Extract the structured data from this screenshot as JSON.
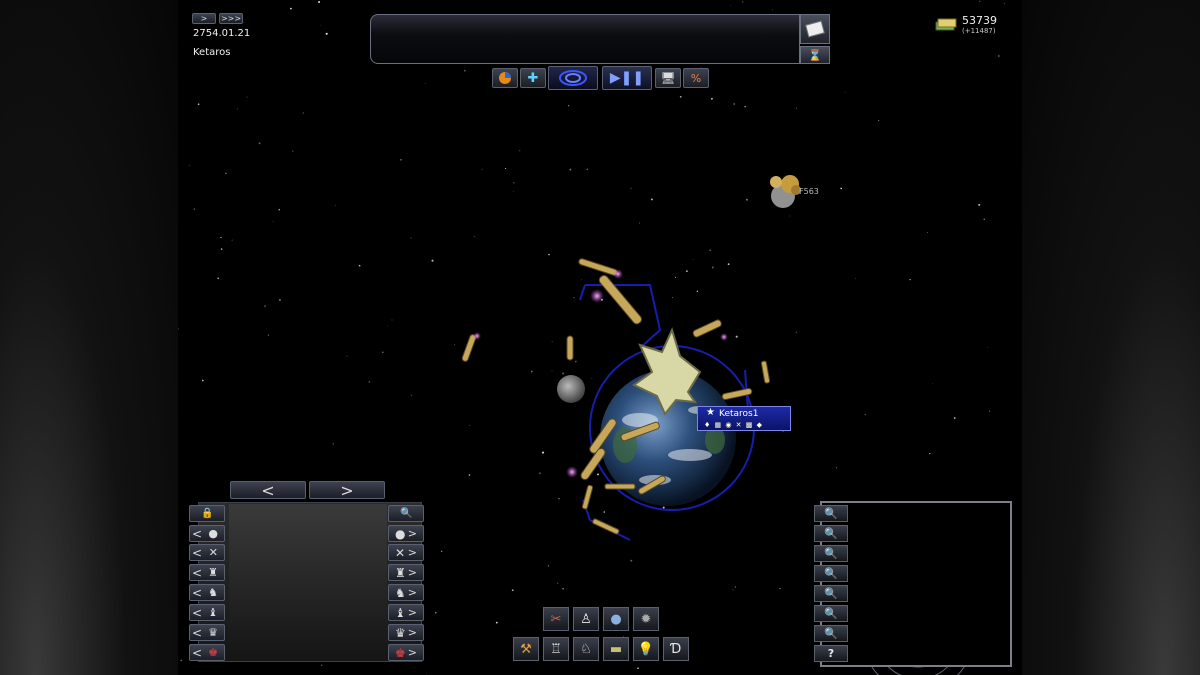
{
  "top_left": {
    "speed_slow_label": ">",
    "speed_fast_label": ">>>",
    "date": "2754.01.21",
    "system_name": "Ketaros"
  },
  "message_bar": {
    "message_icon": "mail-icon",
    "hourglass_icon": "hourglass-icon"
  },
  "toolbar": {
    "buttons": [
      "pie-chart-icon",
      "crosshair-icon",
      "radar-icon",
      "play-pause-icon",
      "monitor-icon",
      "percent-icon"
    ]
  },
  "resources": {
    "credits": "53739",
    "credits_delta": "(+11487)",
    "icon": "money-stack-icon"
  },
  "map": {
    "distant_object_label": "F563",
    "planet": {
      "name": "Ketaros1",
      "stats_icons": "♦ ▦ ◉ ✕ ▩ ◆"
    }
  },
  "left_panel": {
    "nav_prev": "<",
    "nav_next": ">",
    "rows": [
      {
        "left": "🔒",
        "right": "🔍"
      },
      {
        "left": "<",
        "right": ">"
      },
      {
        "left": "<",
        "right": ">"
      },
      {
        "left": "<",
        "right": ">"
      },
      {
        "left": "<",
        "right": ">"
      },
      {
        "left": "<",
        "right": ">"
      },
      {
        "left": "<",
        "right": ">"
      },
      {
        "left": "<",
        "right": ">"
      }
    ]
  },
  "build_bar": {
    "top_row": [
      "tools-icon",
      "soldier-icon",
      "planet-icon",
      "asteroid-icon"
    ],
    "bottom_row": [
      "crane-icon",
      "robot-icon",
      "mech-icon",
      "tank-icon",
      "lightbulb-icon",
      "diplomacy-icon"
    ]
  },
  "minimap_controls": [
    "zoom-in-icon",
    "zoom-remove-icon",
    "zoom-target-icon",
    "zoom-planet-icon",
    "zoom-system-icon",
    "zoom-galaxy-icon",
    "zoom-fleet-icon",
    "help-icon"
  ],
  "minimap_help": "?"
}
